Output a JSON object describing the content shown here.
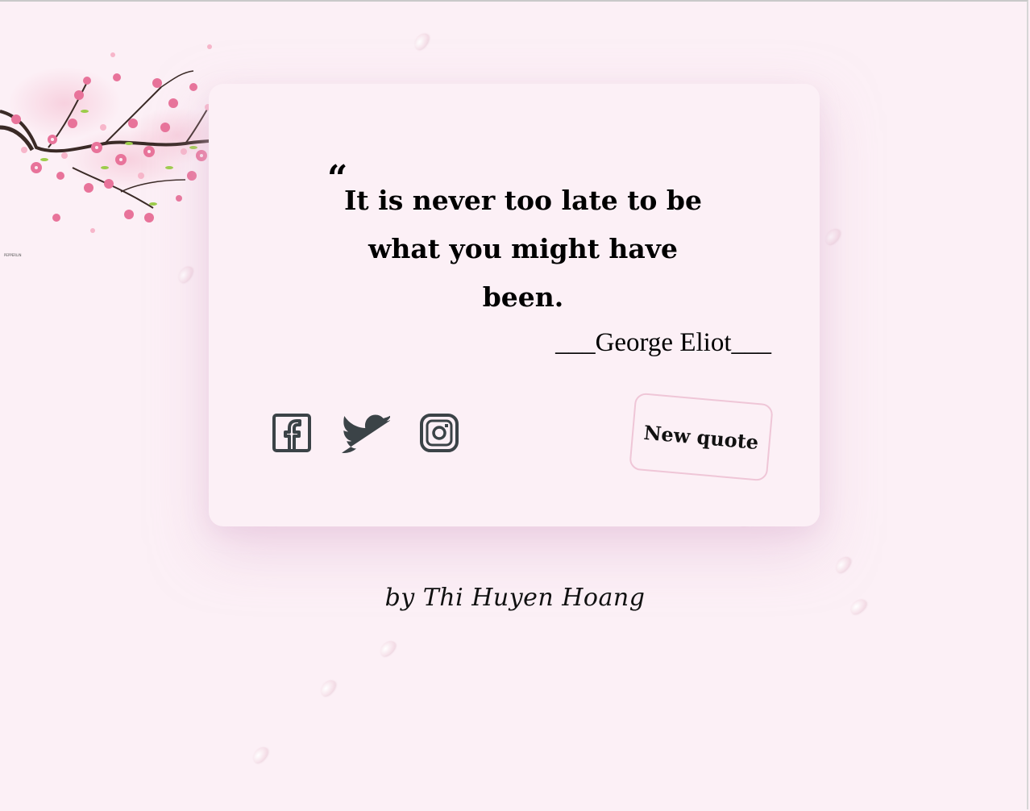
{
  "quote": {
    "open_mark": "“",
    "text": "It is never too late to be what you might have been.",
    "author": "___George Eliot___"
  },
  "social": {
    "facebook": "facebook-icon",
    "twitter": "twitter-icon",
    "instagram": "instagram-icon"
  },
  "actions": {
    "new_quote_label": "New quote"
  },
  "footer": {
    "credit": "by Thi Huyen Hoang"
  },
  "decor": {
    "blossom": "cherry-blossom-branch",
    "watermark": "PEPPERLIN"
  },
  "colors": {
    "background": "#fcf0f6",
    "card": "#fcf0f6",
    "button_border": "#efc6d7",
    "icon": "#3b4347",
    "blossom_pink": "#e8739a",
    "branch": "#3a2a26"
  }
}
